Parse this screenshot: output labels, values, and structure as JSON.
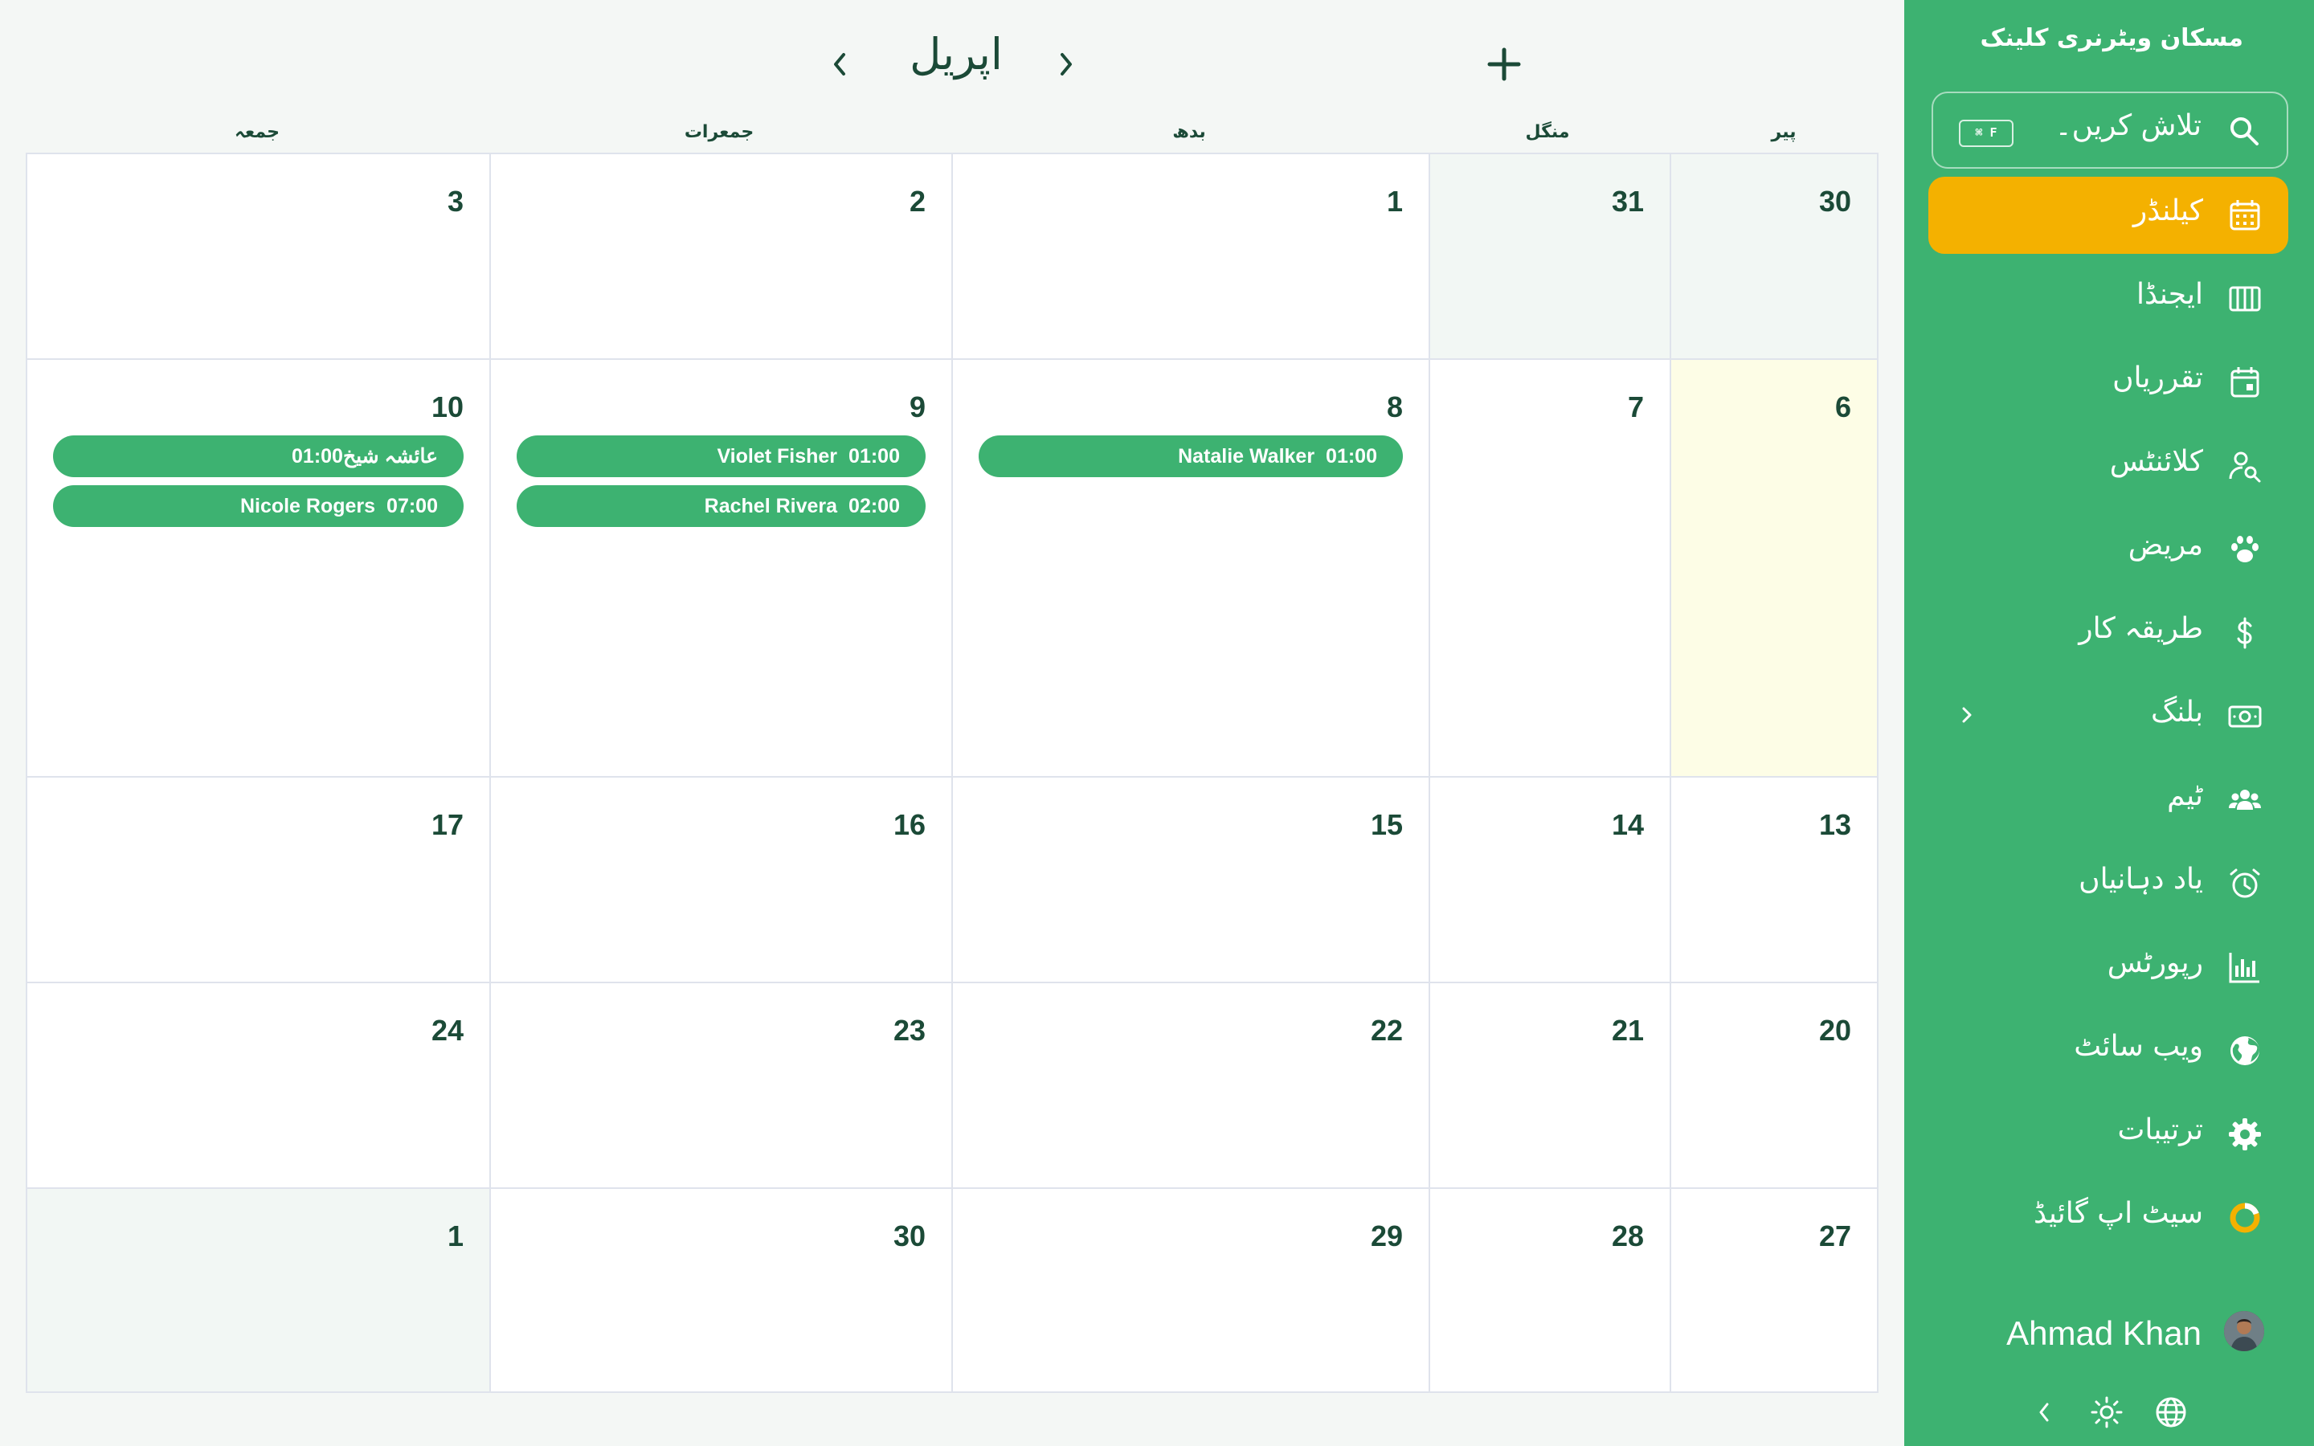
{
  "sidebar": {
    "clinic_name": "مسکان ویٹرنری کلینک",
    "search": {
      "placeholder": "تلاش کریں۔",
      "shortcut": "⌘ F"
    },
    "items": [
      {
        "label": "کیلنڈر",
        "icon": "calendar-icon",
        "active": true
      },
      {
        "label": "ایجنڈا",
        "icon": "agenda-columns-icon"
      },
      {
        "label": "تقرریاں",
        "icon": "appointment-calendar-icon"
      },
      {
        "label": "کلائنٹس",
        "icon": "client-search-icon"
      },
      {
        "label": "مریض",
        "icon": "paw-icon"
      },
      {
        "label": "طریقہ کار",
        "icon": "dollar-icon"
      },
      {
        "label": "بلنگ",
        "icon": "banknote-icon"
      },
      {
        "label": "ٹیم",
        "icon": "team-icon"
      },
      {
        "label": "یاد دہانیاں",
        "icon": "alarm-clock-icon"
      },
      {
        "label": "رپورٹس",
        "icon": "bar-chart-icon"
      },
      {
        "label": "ویب سائٹ",
        "icon": "globe-icon"
      },
      {
        "label": "ترتیبات",
        "icon": "gear-icon"
      },
      {
        "label": "سیٹ اپ گائیڈ",
        "icon": "progress-ring-icon"
      }
    ],
    "user": {
      "name": "Ahmad Khan"
    }
  },
  "calendar": {
    "month": "اپریل",
    "weekdays": [
      "پیر",
      "منگل",
      "بدھ",
      "جمعرات",
      "جمعہ"
    ],
    "weeks": [
      [
        {
          "day": "30",
          "out": true
        },
        {
          "day": "31",
          "out": true
        },
        {
          "day": "1"
        },
        {
          "day": "2"
        },
        {
          "day": "3"
        }
      ],
      [
        {
          "day": "6",
          "today": true
        },
        {
          "day": "7"
        },
        {
          "day": "8",
          "events": [
            {
              "time": "01:00",
              "name": "Natalie Walker"
            }
          ]
        },
        {
          "day": "9",
          "events": [
            {
              "time": "01:00",
              "name": "Violet Fisher"
            },
            {
              "time": "02:00",
              "name": "Rachel Rivera"
            }
          ]
        },
        {
          "day": "10",
          "events": [
            {
              "time": "01:00",
              "name": "عائشہ شیخ"
            },
            {
              "time": "07:00",
              "name": "Nicole Rogers"
            }
          ]
        }
      ],
      [
        {
          "day": "13"
        },
        {
          "day": "14"
        },
        {
          "day": "15"
        },
        {
          "day": "16"
        },
        {
          "day": "17"
        }
      ],
      [
        {
          "day": "20"
        },
        {
          "day": "21"
        },
        {
          "day": "22"
        },
        {
          "day": "23"
        },
        {
          "day": "24"
        }
      ],
      [
        {
          "day": "27"
        },
        {
          "day": "28"
        },
        {
          "day": "29"
        },
        {
          "day": "30"
        },
        {
          "day": "1",
          "out": true
        }
      ]
    ]
  },
  "colors": {
    "primary": "#3db271",
    "active": "#f4b100",
    "today": "#fdfde6",
    "text": "#1b4a37"
  }
}
